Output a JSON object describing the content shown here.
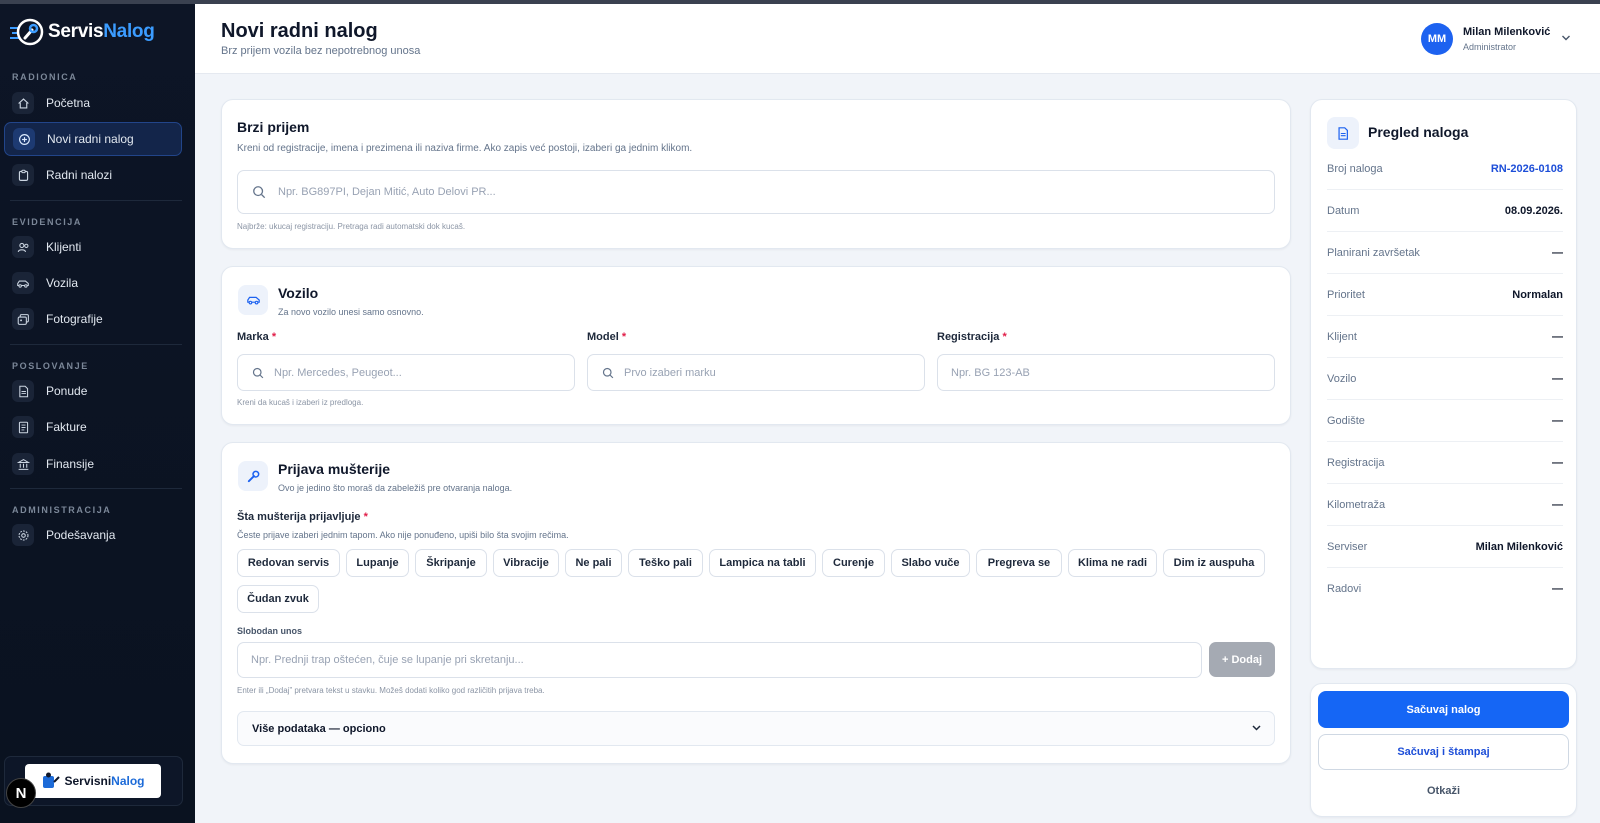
{
  "app": {
    "brand_part1": "Servis",
    "brand_part2": "Nalog"
  },
  "sidebar": {
    "sections": [
      {
        "title": "RADIONICA",
        "items": [
          {
            "label": "Početna",
            "icon": "home-icon"
          },
          {
            "label": "Novi radni nalog",
            "icon": "plus-circle-icon",
            "active": true
          },
          {
            "label": "Radni nalozi",
            "icon": "clipboard-icon"
          }
        ]
      },
      {
        "title": "EVIDENCIJA",
        "items": [
          {
            "label": "Klijenti",
            "icon": "users-icon"
          },
          {
            "label": "Vozila",
            "icon": "car-icon"
          },
          {
            "label": "Fotografije",
            "icon": "images-icon"
          }
        ]
      },
      {
        "title": "POSLOVANJE",
        "items": [
          {
            "label": "Ponude",
            "icon": "document-icon"
          },
          {
            "label": "Fakture",
            "icon": "invoice-icon"
          },
          {
            "label": "Finansije",
            "icon": "bank-icon"
          }
        ]
      },
      {
        "title": "ADMINISTRACIJA",
        "items": [
          {
            "label": "Podešavanja",
            "icon": "gear-icon"
          }
        ]
      }
    ],
    "footer_logo_part1": "Servisni",
    "footer_logo_part2": "Nalog",
    "badge": "N"
  },
  "header": {
    "title": "Novi radni nalog",
    "subtitle": "Brz prijem vozila bez nepotrebnog unosa",
    "user": {
      "initials": "MM",
      "name": "Milan Milenković",
      "role": "Administrator"
    }
  },
  "quick": {
    "title": "Brzi prijem",
    "desc": "Kreni od registracije, imena i prezimena ili naziva firme. Ako zapis već postoji, izaberi ga jednim klikom.",
    "placeholder": "Npr. BG897PI, Dejan Mitić, Auto Delovi PR...",
    "hint": "Najbrže: ukucaj registraciju. Pretraga radi automatski dok kucaš."
  },
  "vehicle": {
    "title": "Vozilo",
    "desc": "Za novo vozilo unesi samo osnovno.",
    "make_label": "Marka",
    "make_placeholder": "Npr. Mercedes, Peugeot...",
    "model_label": "Model",
    "model_placeholder": "Prvo izaberi marku",
    "reg_label": "Registracija",
    "reg_placeholder": "Npr. BG 123-AB",
    "required_mark": "*",
    "hint": "Kreni da kucaš i izaberi iz predloga."
  },
  "complaint": {
    "title": "Prijava mušterije",
    "desc": "Ovo je jedino što moraš da zabeležiš pre otvaranja naloga.",
    "label": "Šta mušterija prijavljuje",
    "required_mark": "*",
    "help": "Česte prijave izaberi jednim tapom. Ako nije ponuđeno, upiši bilo šta svojim rečima.",
    "chips": [
      "Redovan servis",
      "Lupanje",
      "Škripanje",
      "Vibracije",
      "Ne pali",
      "Teško pali",
      "Lampica na tabli",
      "Curenje",
      "Slabo vuče",
      "Pregreva se",
      "Klima ne radi",
      "Dim iz auspuha",
      "Čudan zvuk"
    ],
    "free_label": "Slobodan unos",
    "free_placeholder": "Npr. Prednji trap oštećen, čuje se lupanje pri skretanju...",
    "add_label": "+ Dodaj",
    "free_hint": "Enter ili „Dodaj” pretvara tekst u stavku. Možeš dodati koliko god različitih prijava treba.",
    "more_label": "Više podataka — opciono"
  },
  "summary": {
    "title": "Pregled naloga",
    "rows": [
      {
        "k": "Broj naloga",
        "v": "RN-2026-0108",
        "link": true
      },
      {
        "k": "Datum",
        "v": "08.09.2026."
      },
      {
        "k": "Planirani završetak",
        "v": "—"
      },
      {
        "k": "Prioritet",
        "v": "Normalan"
      },
      {
        "k": "Klijent",
        "v": "—"
      },
      {
        "k": "Vozilo",
        "v": "—"
      },
      {
        "k": "Godište",
        "v": "—"
      },
      {
        "k": "Registracija",
        "v": "—"
      },
      {
        "k": "Kilometraža",
        "v": "—"
      },
      {
        "k": "Serviser",
        "v": "Milan Milenković"
      },
      {
        "k": "Radovi",
        "v": "—"
      }
    ],
    "save": "Sačuvaj nalog",
    "save_print": "Sačuvaj i štampaj",
    "cancel": "Otkaži"
  },
  "colors": {
    "accent": "#1566f5",
    "sidebar_bg": "#0d1526",
    "required": "#e11d48",
    "link": "#1d4ed8"
  }
}
